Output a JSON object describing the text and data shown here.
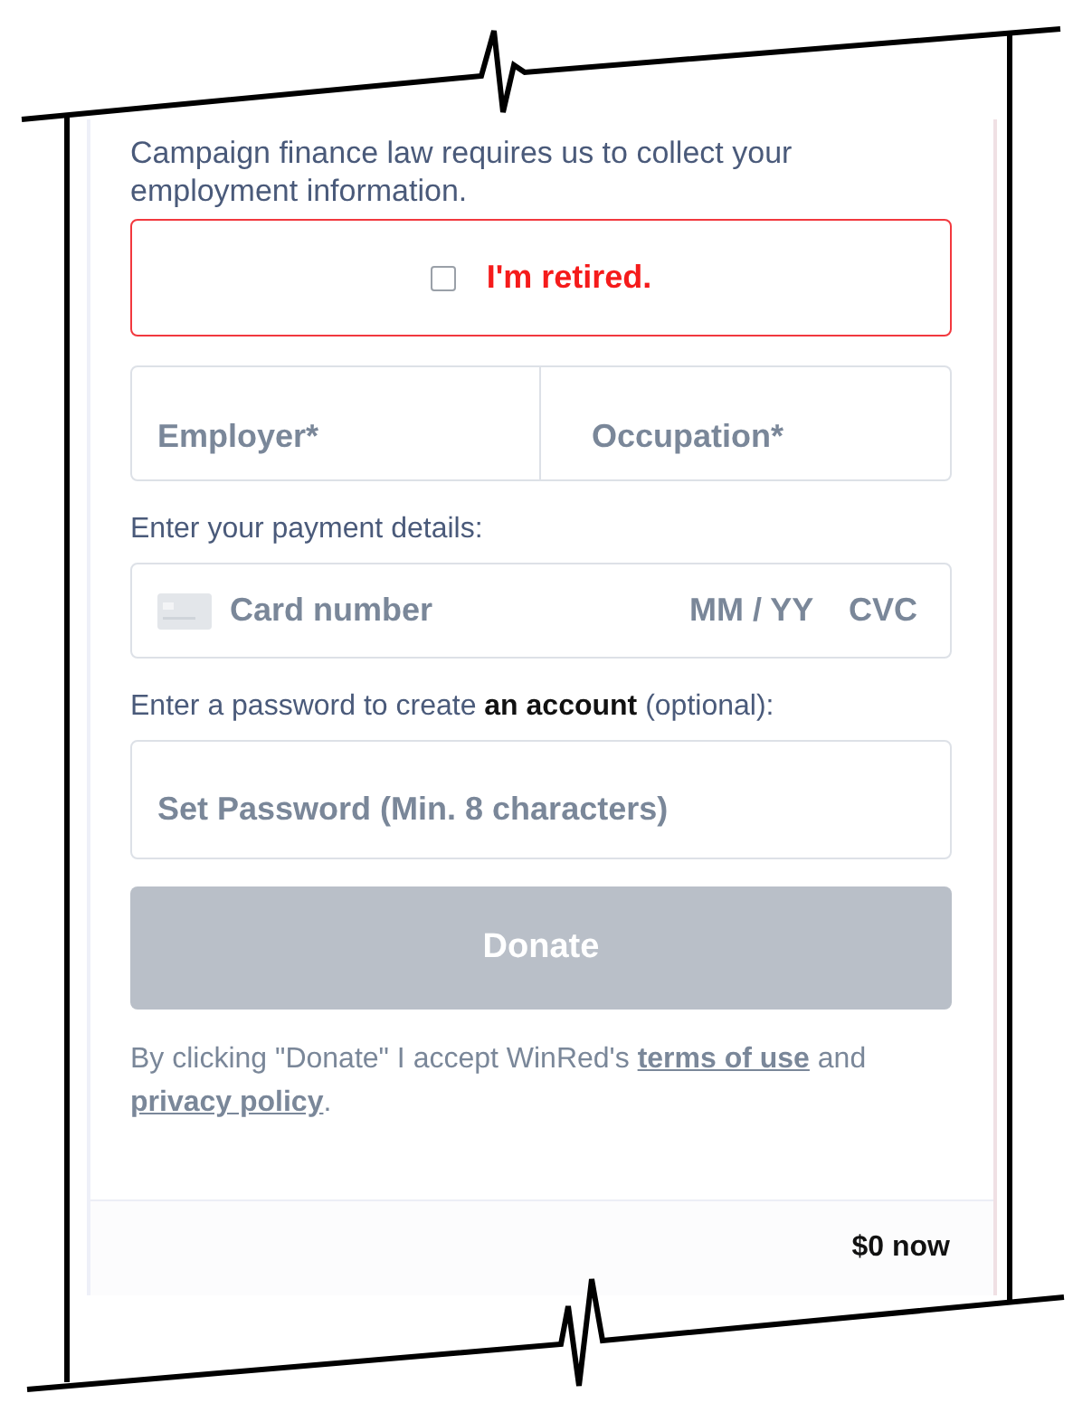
{
  "notice": "Campaign finance law requires us to collect your employment information.",
  "retired": {
    "label": "I'm retired.",
    "checked": false
  },
  "employer": {
    "placeholder": "Employer*"
  },
  "occupation": {
    "placeholder": "Occupation*"
  },
  "payment_label": "Enter your payment details:",
  "card": {
    "placeholder": "Card number",
    "expiry_placeholder": "MM / YY",
    "cvc_placeholder": "CVC"
  },
  "password_label": "Enter a password to create **an account** (optional):",
  "password": {
    "placeholder": "Set Password (Min. 8 characters)"
  },
  "donate": {
    "label": "Donate",
    "disabled": true
  },
  "legal": {
    "text": "By clicking \"Donate\" I accept WinRed's",
    "terms_link": "terms of use",
    "joiner": "and",
    "privacy_link": "privacy policy",
    "end": "."
  },
  "summary": "$0 now"
}
